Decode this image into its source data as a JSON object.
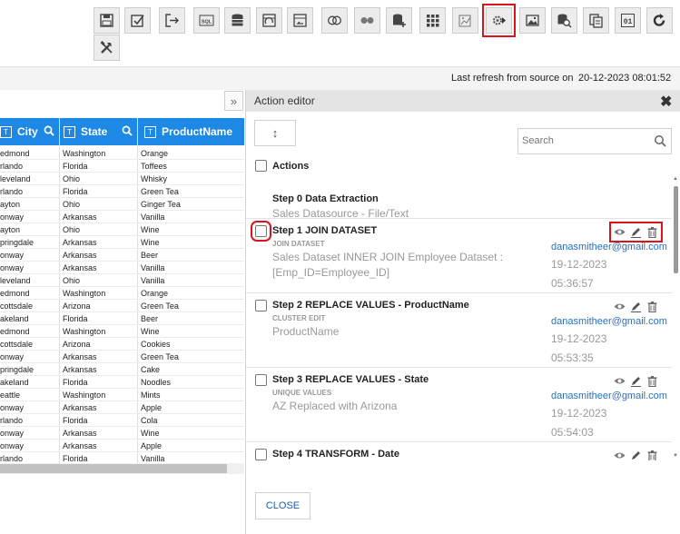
{
  "toolbar": {
    "buttons": [
      {
        "name": "save-icon"
      },
      {
        "name": "save-as-icon"
      },
      {
        "name": "export-icon"
      },
      {
        "name": "sql-icon"
      },
      {
        "name": "database-icon"
      },
      {
        "name": "refresh-table-icon"
      },
      {
        "name": "undo-table-icon"
      },
      {
        "name": "join-icon"
      },
      {
        "name": "link-icon"
      },
      {
        "name": "add-database-icon"
      },
      {
        "name": "grid-icon"
      },
      {
        "name": "chart-edit-icon"
      },
      {
        "name": "action-editor-icon"
      },
      {
        "name": "image-icon"
      },
      {
        "name": "search-database-icon"
      },
      {
        "name": "copy-icon"
      },
      {
        "name": "binary-icon"
      },
      {
        "name": "rotate-icon"
      },
      {
        "name": "tools-icon"
      }
    ]
  },
  "refresh": {
    "label": "Last refresh from source on",
    "timestamp": "20-12-2023 08:01:52"
  },
  "grid": {
    "collapse_label": "»",
    "columns": [
      "City",
      "State",
      "ProductName"
    ],
    "rows": [
      [
        "edmond",
        "Washington",
        "Orange"
      ],
      [
        "rlando",
        "Florida",
        "Toffees"
      ],
      [
        "leveland",
        "Ohio",
        "Whisky"
      ],
      [
        "rlando",
        "Florida",
        "Green Tea"
      ],
      [
        "ayton",
        "Ohio",
        "Ginger Tea"
      ],
      [
        "onway",
        "Arkansas",
        "Vanilla"
      ],
      [
        "ayton",
        "Ohio",
        "Wine"
      ],
      [
        "pringdale",
        "Arkansas",
        "Wine"
      ],
      [
        "onway",
        "Arkansas",
        "Beer"
      ],
      [
        "onway",
        "Arkansas",
        "Vanilla"
      ],
      [
        "leveland",
        "Ohio",
        "Vanilla"
      ],
      [
        "edmond",
        "Washington",
        "Orange"
      ],
      [
        "cottsdale",
        "Arizona",
        "Green Tea"
      ],
      [
        "akeland",
        "Florida",
        "Beer"
      ],
      [
        "edmond",
        "Washington",
        "Wine"
      ],
      [
        "cottsdale",
        "Arizona",
        "Cookies"
      ],
      [
        "onway",
        "Arkansas",
        "Green Tea"
      ],
      [
        "pringdale",
        "Arkansas",
        "Cake"
      ],
      [
        "akeland",
        "Florida",
        "Noodles"
      ],
      [
        "eattle",
        "Washington",
        "Mints"
      ],
      [
        "onway",
        "Arkansas",
        "Apple"
      ],
      [
        "rlando",
        "Florida",
        "Cola"
      ],
      [
        "onway",
        "Arkansas",
        "Wine"
      ],
      [
        "onway",
        "Arkansas",
        "Apple"
      ],
      [
        "rlando",
        "Florida",
        "Vanilla"
      ]
    ]
  },
  "editor": {
    "title": "Action editor",
    "close_glyph": "✖",
    "sort_glyph": "↕",
    "search_placeholder": "Search",
    "actions_label": "Actions",
    "steps": [
      {
        "title": "Step 0 Data Extraction",
        "subtitle": "",
        "desc": "Sales Datasource - File/Text",
        "user": "",
        "date": "",
        "time": ""
      },
      {
        "title": "Step 1 JOIN DATASET",
        "subtitle": "JOIN DATASET",
        "desc": "Sales Dataset INNER JOIN Employee Dataset : [Emp_ID=Employee_ID]",
        "user": "danasmitheer@gmail.com",
        "date": "19-12-2023",
        "time": "05:36:57"
      },
      {
        "title": "Step 2 REPLACE VALUES - ProductName",
        "subtitle": "CLUSTER EDIT",
        "desc": "ProductName",
        "user": "danasmitheer@gmail.com",
        "date": "19-12-2023",
        "time": "05:53:35"
      },
      {
        "title": "Step 3 REPLACE VALUES - State",
        "subtitle": "UNIQUE VALUES",
        "desc": "AZ Replaced with Arizona",
        "user": "danasmitheer@gmail.com",
        "date": "19-12-2023",
        "time": "05:54:03"
      },
      {
        "title": "Step 4 TRANSFORM - Date",
        "subtitle": "",
        "desc": "",
        "user": "",
        "date": "",
        "time": ""
      }
    ],
    "close_label": "CLOSE"
  }
}
